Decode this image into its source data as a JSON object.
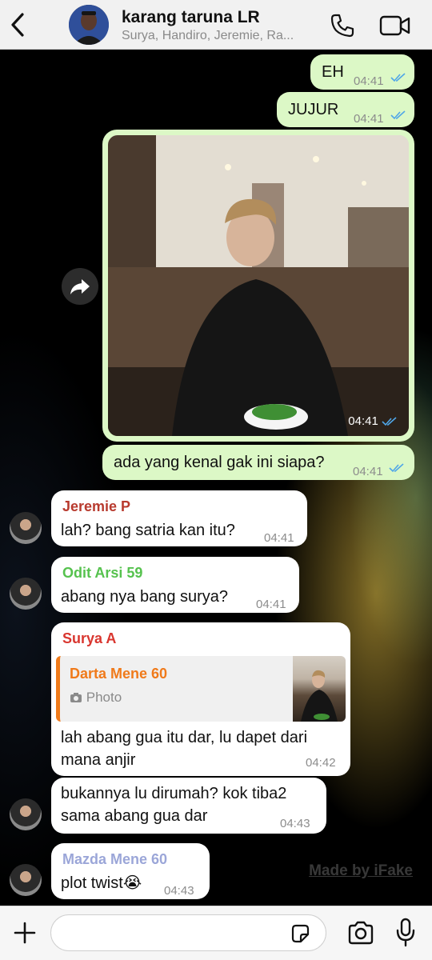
{
  "header": {
    "title": "karang taruna LR",
    "members": "Surya, Handiro, Jeremie, Ra..."
  },
  "messages": [
    {
      "id": "m1",
      "direction": "out",
      "text": "EH",
      "time": "04:41",
      "status": "read"
    },
    {
      "id": "m2",
      "direction": "out",
      "text": "JUJUR",
      "time": "04:41",
      "status": "read"
    },
    {
      "id": "m3",
      "direction": "out",
      "type": "photo",
      "time": "04:41",
      "status": "read"
    },
    {
      "id": "m4",
      "direction": "out",
      "text": "ada yang kenal gak ini siapa?",
      "time": "04:41",
      "status": "read"
    },
    {
      "id": "m5",
      "direction": "in",
      "sender": "Jeremie P",
      "sender_color": "#b83a2e",
      "text": "lah? bang satria kan itu?",
      "time": "04:41"
    },
    {
      "id": "m6",
      "direction": "in",
      "sender": "Odit Arsi 59",
      "sender_color": "#56c24e",
      "text": "abang nya bang surya?",
      "time": "04:41"
    },
    {
      "id": "m7",
      "direction": "in",
      "sender": "Surya A",
      "sender_color": "#d9362f",
      "reply": {
        "name": "Darta Mene 60",
        "name_color": "#f07a1a",
        "type": "Photo"
      },
      "text_line1": "lah abang gua itu dar, lu dapet dari",
      "text_line2": "mana anjir",
      "time": "04:42"
    },
    {
      "id": "m8",
      "direction": "in",
      "text_line1": "bukannya lu dirumah? kok tiba2",
      "text_line2": "sama abang gua dar",
      "time": "04:43"
    },
    {
      "id": "m9",
      "direction": "in",
      "sender": "Mazda Mene 60",
      "sender_color": "#9ba6d8",
      "text": "plot twist",
      "emoji": "😭",
      "time": "04:43"
    }
  ],
  "watermark": "Made by iFake",
  "composer": {
    "placeholder": ""
  },
  "colors": {
    "out_bubble": "#dcf8c6",
    "in_bubble": "#ffffff",
    "tick_blue": "#4fa6e8"
  }
}
